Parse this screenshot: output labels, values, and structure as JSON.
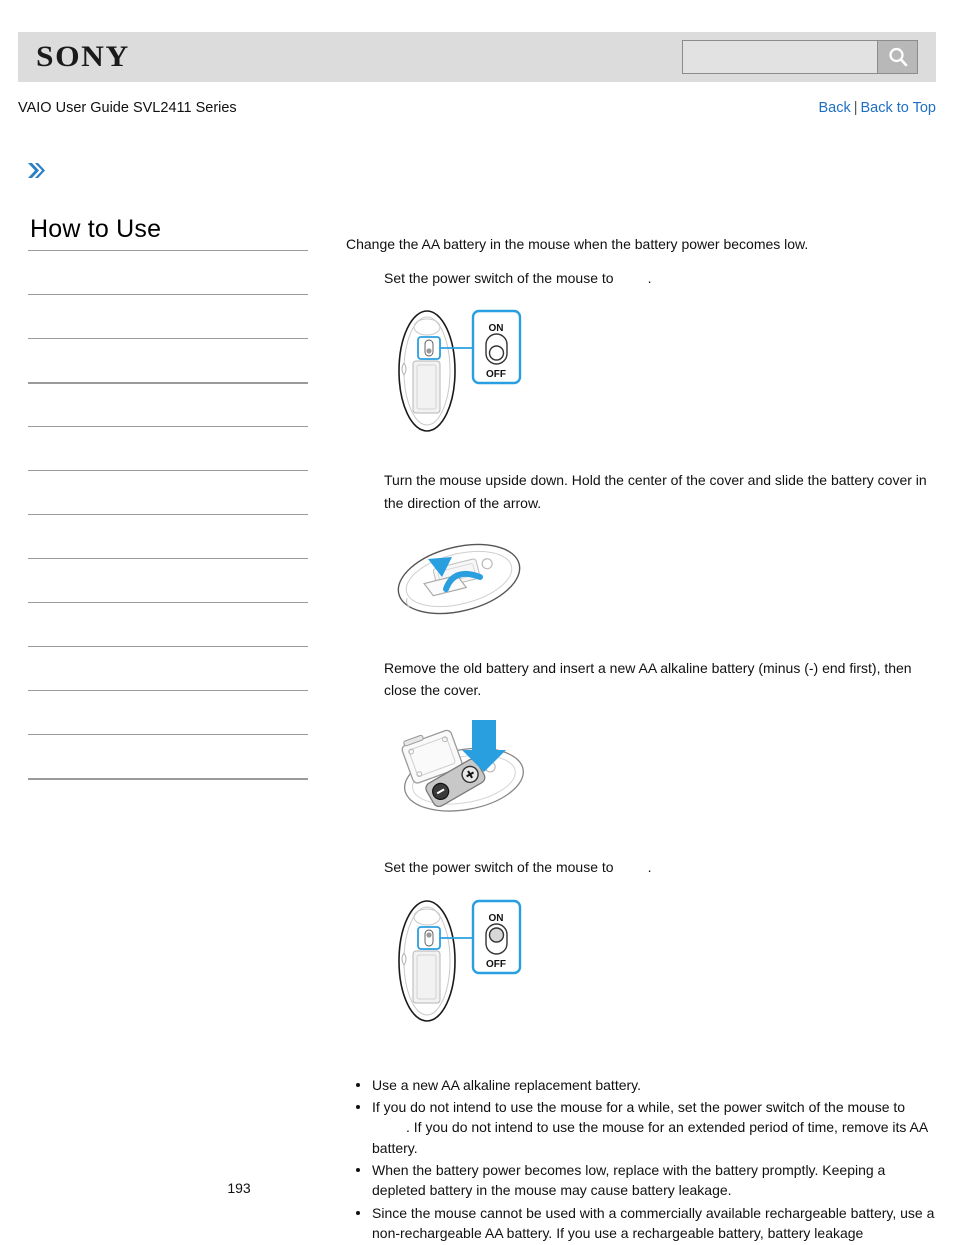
{
  "header": {
    "logo_text": "SONY",
    "search": {
      "value": "",
      "placeholder": "",
      "icon": "search-icon",
      "button_label": ""
    }
  },
  "breadcrumb": {
    "doc_title": "VAIO User Guide SVL2411 Series",
    "back_label": "Back",
    "separator": "|",
    "back_to_top_label": "Back to Top"
  },
  "sidebar": {
    "chevron_icon": "double-chevron-right-icon",
    "title": "How to Use",
    "items": [
      {
        "label": ""
      },
      {
        "label": ""
      },
      {
        "label": ""
      },
      {
        "label": ""
      },
      {
        "label": ""
      },
      {
        "label": ""
      },
      {
        "label": ""
      },
      {
        "label": ""
      },
      {
        "label": ""
      },
      {
        "label": ""
      },
      {
        "label": ""
      },
      {
        "label": ""
      }
    ]
  },
  "main": {
    "lead": "Change the AA battery in the mouse when the battery power becomes low.",
    "steps": [
      {
        "text_before": "Set the power switch of the mouse to",
        "text_after": ".",
        "figure": "mouse-bottom-switch-off-diagram"
      },
      {
        "text_before": "Turn the mouse upside down. Hold the center of the cover and slide the battery cover in the direction of the arrow.",
        "text_after": "",
        "figure": "mouse-slide-cover-diagram"
      },
      {
        "text_before": "Remove the old battery and insert a new AA alkaline battery (minus (-) end first), then close the cover.",
        "text_after": "",
        "figure": "mouse-insert-battery-diagram"
      },
      {
        "text_before": "Set the power switch of the mouse to",
        "text_after": ".",
        "figure": "mouse-bottom-switch-on-diagram"
      }
    ],
    "notes": [
      {
        "part1": "Use a new AA alkaline replacement battery.",
        "part2": "",
        "has_gap": false
      },
      {
        "part1": "If you do not intend to use the mouse for a while, set the power switch of the mouse to",
        "part2": ". If you do not intend to use the mouse for an extended period of time, remove its AA battery.",
        "has_gap": true
      },
      {
        "part1": "When the battery power becomes low, replace with the battery promptly. Keeping a depleted battery in the mouse may cause battery leakage.",
        "part2": "",
        "has_gap": false
      },
      {
        "part1": "Since the mouse cannot be used with a commercially available rechargeable battery, use a non-rechargeable AA battery. If you use a rechargeable battery, battery leakage",
        "part2": "",
        "has_gap": false
      }
    ],
    "switch_labels": {
      "on": "ON",
      "off": "OFF"
    }
  },
  "footer": {
    "page_number": "193"
  },
  "colors": {
    "header_bg": "#dcdcdc",
    "link_blue": "#1f6fc4",
    "accent_blue": "#2a9fe0",
    "divider_gray": "#9a9a9a"
  }
}
